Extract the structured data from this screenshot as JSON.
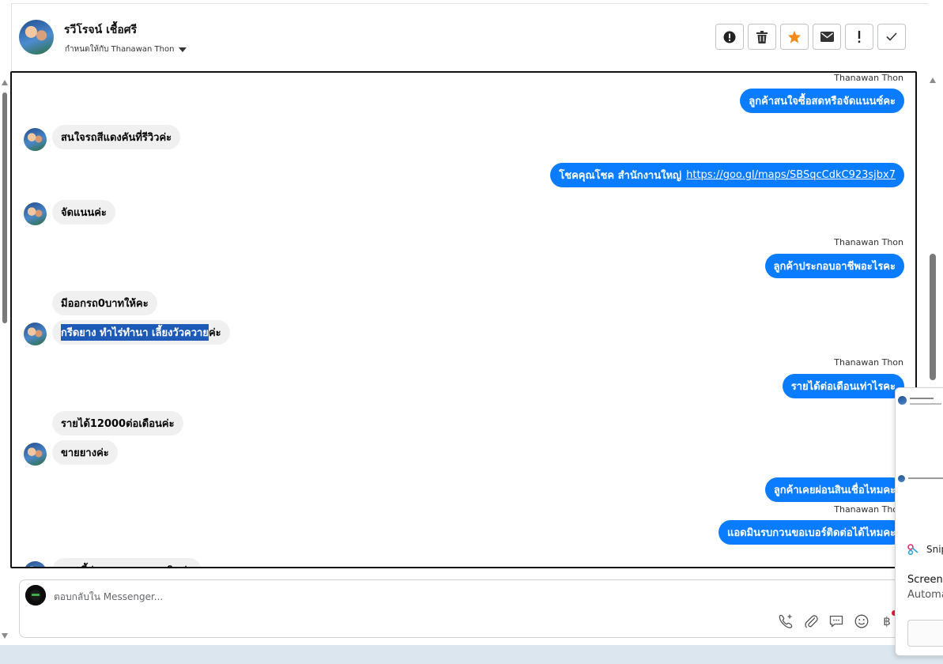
{
  "header": {
    "contact_name": "รวีโรจน์ เชื้อศรี",
    "assigned_to": "กำหนดให้กับ Thanawan Thon",
    "toolbar": [
      {
        "name": "spam-button",
        "icon": "alert-circle-icon"
      },
      {
        "name": "delete-button",
        "icon": "trash-icon"
      },
      {
        "name": "star-button",
        "icon": "star-icon",
        "color": "#f28b1e"
      },
      {
        "name": "mark-unread-button",
        "icon": "envelope-icon"
      },
      {
        "name": "follow-up-button",
        "icon": "exclamation-icon"
      },
      {
        "name": "mark-done-button",
        "icon": "check-icon"
      }
    ]
  },
  "conversation": {
    "agent_name": "Thanawan Thon",
    "messages": [
      {
        "dir": "out",
        "text": "ลูกค้าสนใจซื้อสดหรือจัดแนนซ์คะ",
        "sender": "Thanawan Thon"
      },
      {
        "dir": "in",
        "text": "สนใจรถสีแดงคันที่รีวิวค่ะ"
      },
      {
        "dir": "out",
        "text": "โชคคุณโชค สำนักงานใหญ่",
        "link": "https://goo.gl/maps/SBSqcCdkC923sjbx7"
      },
      {
        "dir": "in",
        "text": "จัดแนนค่ะ"
      },
      {
        "dir": "out",
        "text": "ลูกค้าประกอบอาชีพอะไรคะ",
        "sender": "Thanawan Thon"
      },
      {
        "dir": "in",
        "text": "มีออกรถ0บาทให้คะ"
      },
      {
        "dir": "in",
        "text_selected": "กรีดยาง ทำไร่ทำนา เลี้ยงวัวควาย",
        "text_rest": "ค่ะ"
      },
      {
        "dir": "out",
        "text": "รายได้ต่อเดือนเท่าไรคะ",
        "sender": "Thanawan Thon"
      },
      {
        "dir": "in",
        "text": "รายได้12000ต่อเดือนค่ะ"
      },
      {
        "dir": "in",
        "text": "ขายยางค่ะ"
      },
      {
        "dir": "out",
        "text": "ลูกค้าเคยผ่อนสินเชื่อไหมคะ"
      },
      {
        "dir": "out",
        "text": "แอดมินรบกวนขอเบอร์ติดต่อได้ไหมคะ",
        "sender": "Thanawan Thon"
      },
      {
        "dir": "in",
        "text": "ตอนนี้ผ่อน ธนาคารออมสินค่ะ"
      }
    ]
  },
  "composer": {
    "placeholder": "ตอบกลับใน Messenger...",
    "icons": [
      "phone-plus-icon",
      "paperclip-icon",
      "chat-bubble-icon",
      "emoji-icon",
      "baht-icon"
    ],
    "baht_symbol": "฿"
  },
  "toast": {
    "app_name": "Snip",
    "line1": "Screens",
    "line2": "Automa"
  }
}
